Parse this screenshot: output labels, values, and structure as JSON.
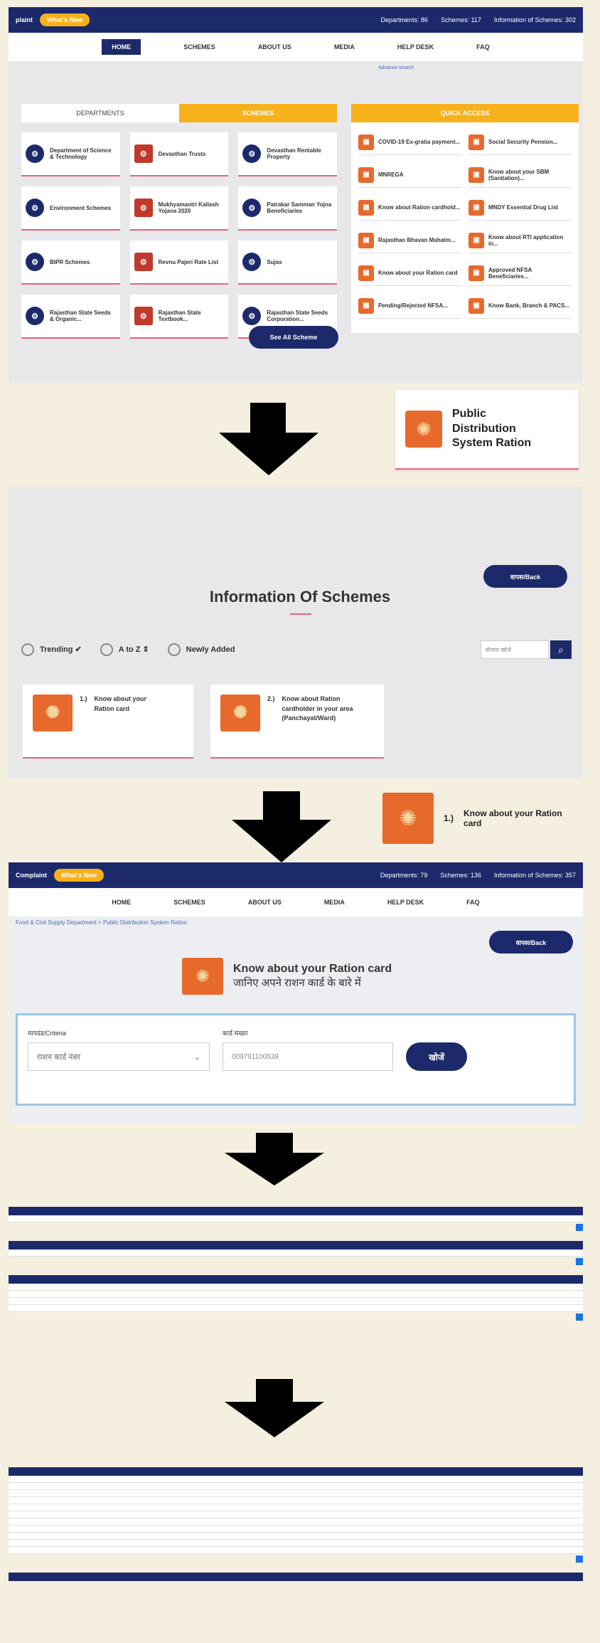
{
  "header": {
    "complaint_label": "plaint",
    "whats_new": "What's New",
    "departments": "Departments: 86",
    "schemes": "Schemes: 117",
    "information": "Information of Schemes: 302"
  },
  "header2": {
    "complaint_label": "Complaint",
    "whats_new": "What's New",
    "departments": "Departments: 79",
    "schemes": "Schemes: 136",
    "information": "Information of Schemes: 357"
  },
  "nav": [
    "HOME",
    "SCHEMES",
    "ABOUT US",
    "MEDIA",
    "HELP DESK",
    "FAQ"
  ],
  "advance_search": "Advance search",
  "section_tabs": {
    "departments": "DEPARTMENTS",
    "schemes": "SCHEMES"
  },
  "departments_list": [
    "Department of Science & Technology",
    "Devasthan Trusts",
    "Devasthan Rentable Property",
    "Environment Schemes",
    "Mukhyamantri Kailash Yojana 2020",
    "Patrakar Samman Yojna Beneficiaries",
    "BIPR Schemes",
    "Revnu Pajeri Rate List",
    "Sujas",
    "Rajasthan State Seeds & Organic...",
    "Rajasthan State Textbook...",
    "Rajasthan State Seeds Corporation..."
  ],
  "quick_access": {
    "title": "QUICK ACCESS",
    "items": [
      "COVID-19 Ex-gratia payment...",
      "Social Security Pension...",
      "MNREGA",
      "Know about your SBM (Sanitation)...",
      "Know about Ration cardhold...",
      "MNDY Essential Drug List",
      "Rajasthan Bhavan Mahatm...",
      "Know about RTI application in...",
      "Know about your Ration card",
      "Approved NFSA Beneficiaries...",
      "Pending/Rejected NFSA...",
      "Know Bank, Branch & PACS..."
    ]
  },
  "see_all": "See All Scheme",
  "callout1": "Public Distribution System Ration",
  "back_label": "वापस/Back",
  "info_title": "Information Of Schemes",
  "filters": {
    "trending": "Trending",
    "atoz": "A to Z",
    "newly": "Newly Added"
  },
  "search_placeholder": "योजना खोजें",
  "scheme_cards": [
    {
      "num": "1.)",
      "text": "Know about your Ration card"
    },
    {
      "num": "2.)",
      "text": "Know about Ration cardholder in your area (Panchayat/Ward)"
    }
  ],
  "callout2": {
    "num": "1.)",
    "text": "Know about your Ration card"
  },
  "breadcrumb": "Food & Civil Supply Department > Public Distribution System Ration",
  "kyrc": {
    "en": "Know about your Ration card",
    "hi": "जानिए अपने राशन कार्ड के बारे में"
  },
  "form": {
    "criteria_label": "मापदंड/Criteria",
    "criteria_value": "राशन कार्ड नंबर",
    "number_label": "कार्ड संख्या",
    "number_value": "009791100539",
    "submit": "खोजें"
  },
  "icons": [
    "science-emblem-icon",
    "temple-icon",
    "ration-wheat-icon",
    "search-icon",
    "check-icon",
    "sort-icon"
  ],
  "colors": {
    "navy": "#1c2a6b",
    "yellow": "#f7b21b",
    "orange": "#e8692c",
    "pink": "#e3667e",
    "grey": "#e8e8ea"
  }
}
